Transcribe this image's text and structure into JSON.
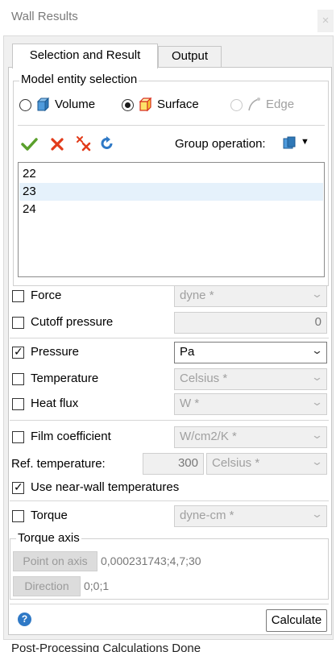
{
  "window": {
    "title": "Wall Results",
    "close_glyph": "×"
  },
  "tabs": [
    {
      "label": "Selection and Result",
      "active": true
    },
    {
      "label": "Output",
      "active": false
    }
  ],
  "model_entity": {
    "group_label": "Model entity selection",
    "options": [
      {
        "label": "Volume",
        "selected": false,
        "enabled": true,
        "icon": "volume-cube-icon"
      },
      {
        "label": "Surface",
        "selected": true,
        "enabled": true,
        "icon": "surface-cube-icon"
      },
      {
        "label": "Edge",
        "selected": false,
        "enabled": false,
        "icon": "edge-curve-icon"
      }
    ],
    "toolbar": {
      "icons": [
        "check-arrow-icon",
        "delete-x-icon",
        "delete-all-icon",
        "refresh-icon"
      ],
      "group_operation_label": "Group operation:",
      "group_operation_icon": "group-cube-icon"
    },
    "list": [
      {
        "value": "22",
        "selected": false
      },
      {
        "value": "23",
        "selected": true
      },
      {
        "value": "24",
        "selected": false
      }
    ]
  },
  "results": {
    "force": {
      "label": "Force",
      "checked": false,
      "unit": "dyne *"
    },
    "cutoff": {
      "label": "Cutoff pressure",
      "checked": false,
      "value": "0"
    },
    "pressure": {
      "label": "Pressure",
      "checked": true,
      "unit": "Pa"
    },
    "temperature": {
      "label": "Temperature",
      "checked": false,
      "unit": "Celsius *"
    },
    "heat_flux": {
      "label": "Heat flux",
      "checked": false,
      "unit": "W *"
    },
    "film_coefficient": {
      "label": "Film coefficient",
      "checked": false,
      "unit": "W/cm2/K *"
    },
    "ref_temperature": {
      "label": "Ref. temperature:",
      "value": "300",
      "unit": "Celsius *"
    },
    "near_wall": {
      "label": "Use near-wall temperatures",
      "checked": true
    },
    "torque": {
      "label": "Torque",
      "checked": false,
      "unit": "dyne-cm *"
    }
  },
  "torque_axis": {
    "group_label": "Torque axis",
    "point_button": "Point on axis",
    "point_value": "0,000231743;4,7;30",
    "direction_button": "Direction",
    "direction_value": "0;0;1"
  },
  "footer": {
    "help_icon_glyph": "?",
    "calculate_label": "Calculate"
  },
  "status": {
    "text": "Post-Processing Calculations Done"
  },
  "colors": {
    "selection": "#e5f1fb",
    "help_blue": "#2f79c6",
    "check_green": "#5aa02c",
    "delete_red": "#e23b1a"
  }
}
